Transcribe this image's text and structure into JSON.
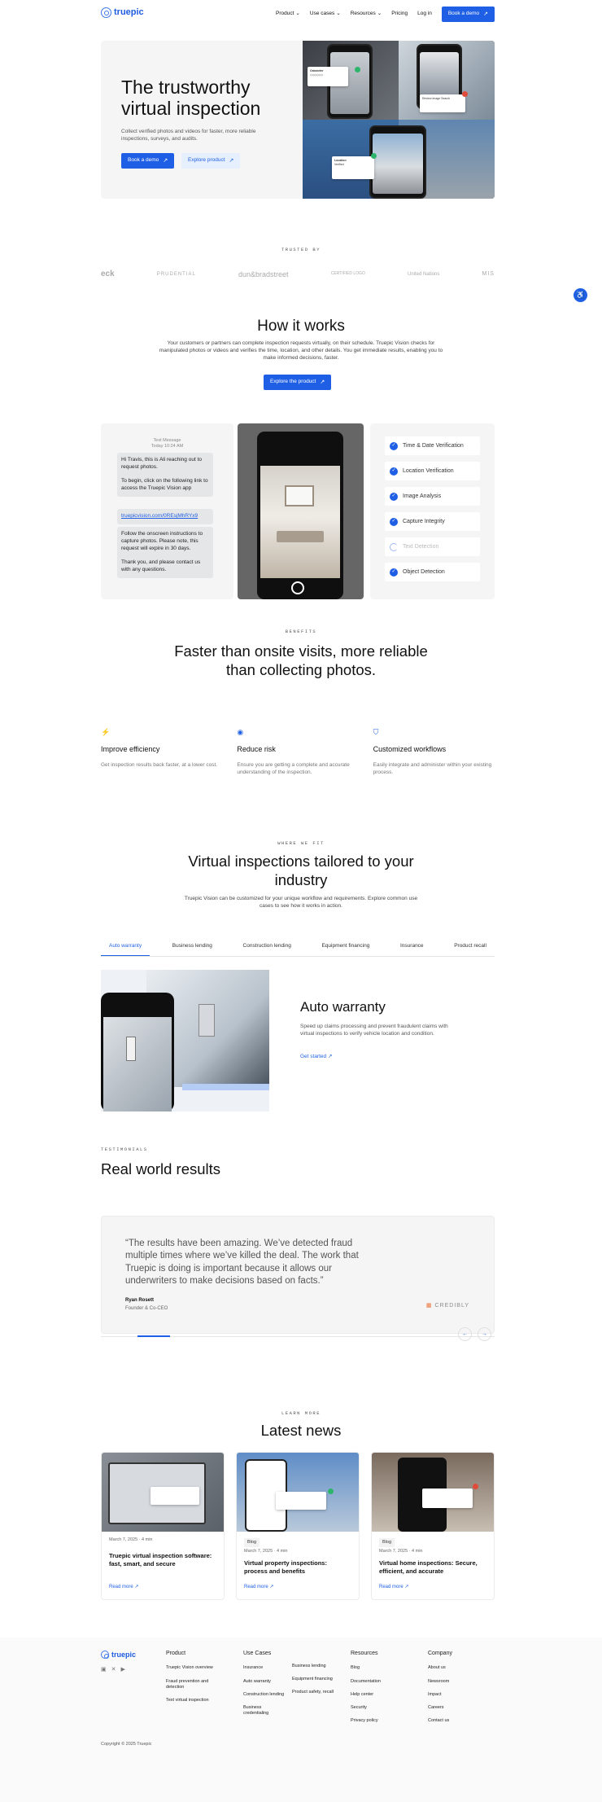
{
  "nav": {
    "brand": "truepic",
    "items": [
      "Product",
      "Use cases",
      "Resources",
      "Pricing",
      "Log in"
    ],
    "cta": "Book a demo"
  },
  "hero": {
    "title": "The trustworthy virtual inspection",
    "subtitle": "Collect verified photos and videos for faster, more reliable inspections, surveys, and audits.",
    "btn_primary": "Book a demo",
    "btn_secondary": "Explore product"
  },
  "trusted": {
    "eyebrow": "TRUSTED BY",
    "logos": [
      "eck",
      "PRUDENTIAL",
      "dun&bradstreet",
      "CERTIFIED LOGO",
      "United Nations",
      "MIS"
    ]
  },
  "how": {
    "title": "How it works",
    "text": "Your customers or partners can complete inspection requests virtually, on their schedule. Truepic Vision checks for manipulated photos or videos and verifies the time, location, and other details. You get immediate results, enabling you to make informed decisions, faster.",
    "cta": "Explore the product",
    "sms_head": "Text Message",
    "sms_time": "Today 10:24 AM",
    "msg1": "Hi Travis, this is Ali reaching out to request photos.\n\nTo begin, click on the following link to access the Truepic Vision app",
    "link": "truepicvision.com/0REsjMhRYx9",
    "msg2": "Follow the onscreen instructions to capture photos. Please note, this request will expire in 30 days.\n\nThank you, and please contact us with any questions.",
    "checks": [
      "Time & Date Verification",
      "Location Verification",
      "Image Analysis",
      "Capture Integrity",
      "Text Detection",
      "Object Detection"
    ]
  },
  "benefits": {
    "eyebrow": "BENEFITS",
    "title": "Faster than onsite visits, more reliable than collecting photos.",
    "items": [
      {
        "title": "Improve efficiency",
        "text": "Get inspection results back faster, at a lower cost."
      },
      {
        "title": "Reduce risk",
        "text": "Ensure you are getting a complete and accurate understanding of the inspection."
      },
      {
        "title": "Customized workflows",
        "text": "Easily integrate and administer within your existing process."
      }
    ]
  },
  "industry": {
    "eyebrow": "WHERE WE FIT",
    "title": "Virtual inspections tailored to your industry",
    "text": "Truepic Vision can be customized for your unique workflow and requirements. Explore common use cases to see how it works in action.",
    "tabs": [
      "Auto warranty",
      "Business lending",
      "Construction lending",
      "Equipment financing",
      "Insurance",
      "Product recall"
    ],
    "panel_title": "Auto warranty",
    "panel_text": "Speed up claims processing and prevent fraudulent claims with virtual inspections to verify vehicle location and condition.",
    "panel_cta": "Get started"
  },
  "testimonials": {
    "eyebrow": "TESTIMONIALS",
    "title": "Real world results",
    "quote": "“The results have been amazing. We’ve detected fraud multiple times where we’ve killed the deal. The work that Truepic is doing is important because it allows our underwriters to make decisions based on facts.”",
    "name": "Ryan Rosett",
    "role": "Founder & Co-CEO",
    "company": "CREDIBLY"
  },
  "news": {
    "eyebrow": "LEARN MORE",
    "title": "Latest news",
    "cards": [
      {
        "tag": "",
        "meta": "March 7, 2025  ·  4 min",
        "title": "Truepic virtual inspection software: fast, smart, and secure",
        "more": "Read more"
      },
      {
        "tag": "Blog",
        "meta": "March 7, 2025  ·  4 min",
        "title": "Virtual property inspections: process and benefits",
        "more": "Read more"
      },
      {
        "tag": "Blog",
        "meta": "March 7, 2025  ·  4 min",
        "title": "Virtual home inspections: Secure, efficient, and accurate",
        "more": "Read more"
      }
    ]
  },
  "footer": {
    "brand": "truepic",
    "product_h": "Product",
    "product": [
      "Truepic Vision overview",
      "Fraud prevention and detection",
      "Text virtual inspection"
    ],
    "usecases_h": "Use Cases",
    "usecases_a": [
      "Insurance",
      "Auto warranty",
      "Construction lending",
      "Business credentialing"
    ],
    "usecases_b": [
      "Business lending",
      "Equipment financing",
      "Product safety, recall"
    ],
    "resources_h": "Resources",
    "resources": [
      "Blog",
      "Documentation",
      "Help center",
      "Security",
      "Privacy policy"
    ],
    "company_h": "Company",
    "company": [
      "About us",
      "Newsroom",
      "Impact",
      "Careers",
      "Contact us"
    ],
    "copyright": "Copyright © 2025 Truepic"
  },
  "colors": {
    "accent": "#1f5fe6",
    "accent_light": "#e6effd",
    "panel": "#f5f5f6"
  }
}
